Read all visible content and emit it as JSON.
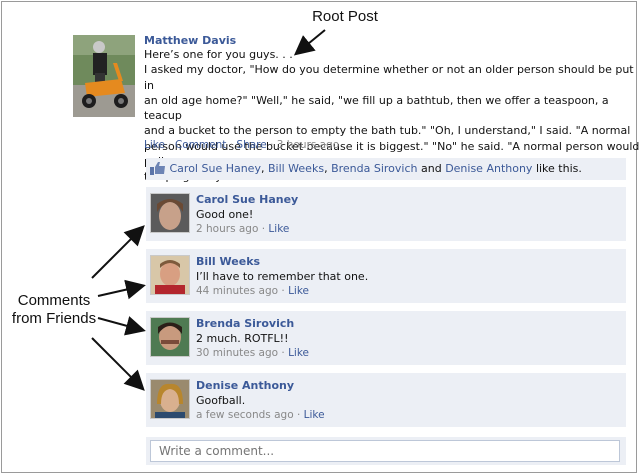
{
  "annotations": {
    "root_post_label": "Root Post",
    "comments_label_line1": "Comments",
    "comments_label_line2": "from Friends"
  },
  "post": {
    "author": "Matthew Davis",
    "lines": [
      "Here’s one for you guys. . .",
      "I asked my doctor, \"How do you determine whether or not an older person should be put in",
      "an old age home?\"  \"Well,\" he said, \"we fill up a bathtub, then we offer a teaspoon, a teacup",
      "and a bucket to the person to empty the bath tub.\"  \"Oh, I understand,\" I said. \"A normal",
      "person would use the bucket because it is biggest.\"  \"No\" he said. \"A normal person would pull",
      "the plug. Do you want a bed near the window?\""
    ],
    "actions": {
      "like": "Like",
      "comment": "Comment",
      "share": "Share",
      "separator": " · ",
      "time": "3 hours ago"
    }
  },
  "likes": {
    "names": [
      "Carol Sue Haney",
      "Bill Weeks",
      "Brenda Sirovich",
      "Denise Anthony"
    ],
    "sep1": ", ",
    "and_text": " and ",
    "suffix": " like this."
  },
  "comments": [
    {
      "name": "Carol Sue Haney",
      "text": "Good one!",
      "time": "2 hours ago",
      "like": "Like"
    },
    {
      "name": "Bill Weeks",
      "text": "I’ll have to remember that one.",
      "time": "44 minutes ago",
      "like": "Like"
    },
    {
      "name": "Brenda Sirovich",
      "text": "2 much.  ROTFL!!",
      "time": "30 minutes ago",
      "like": "Like"
    },
    {
      "name": "Denise Anthony",
      "text": "Goofball.",
      "time": "a few seconds ago",
      "like": "Like"
    }
  ],
  "comment_input": {
    "placeholder": "Write a comment..."
  },
  "colors": {
    "link": "#3b5998",
    "panel": "#eceff5",
    "muted": "#888888"
  }
}
